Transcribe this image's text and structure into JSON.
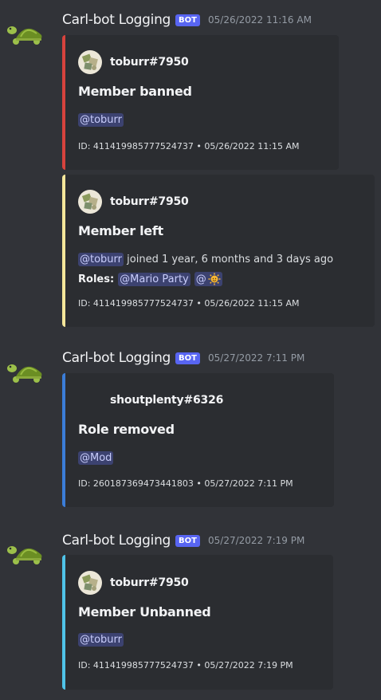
{
  "messages": [
    {
      "username": "Carl-bot Logging",
      "bot_tag": "BOT",
      "timestamp": "05/26/2022 11:16 AM",
      "embeds": [
        {
          "color": "#d6433d",
          "author": "toburr#7950",
          "title": "Member banned",
          "mention": "@toburr",
          "footer": "ID: 411419985777524737 • 05/26/2022 11:15 AM"
        },
        {
          "color": "#f5e69a",
          "author": "toburr#7950",
          "title": "Member left",
          "mention": "@toburr",
          "joined_text": " joined 1 year, 6 months and 3 days ago",
          "roles_label": "Roles:",
          "role_1": "@Mario Party",
          "role_2": "@",
          "footer": "ID: 411419985777524737 • 05/26/2022 11:15 AM"
        }
      ]
    },
    {
      "username": "Carl-bot Logging",
      "bot_tag": "BOT",
      "timestamp": "05/27/2022 7:11 PM",
      "embeds": [
        {
          "color": "#3b7dd8",
          "author": "shoutplenty#6326",
          "title": "Role removed",
          "mention": "@Mod",
          "footer": "ID: 260187369473441803 • 05/27/2022 7:11 PM"
        }
      ]
    },
    {
      "username": "Carl-bot Logging",
      "bot_tag": "BOT",
      "timestamp": "05/27/2022 7:19 PM",
      "embeds": [
        {
          "color": "#4fc3e8",
          "author": "toburr#7950",
          "title": "Member Unbanned",
          "mention": "@toburr",
          "footer": "ID: 411419985777524737 • 05/27/2022 7:19 PM"
        }
      ]
    }
  ],
  "icons": {
    "bot_avatar": "turtle-icon",
    "author_avatar": "user-avatar-icon",
    "role_emoji": "sun-emoji-icon"
  }
}
